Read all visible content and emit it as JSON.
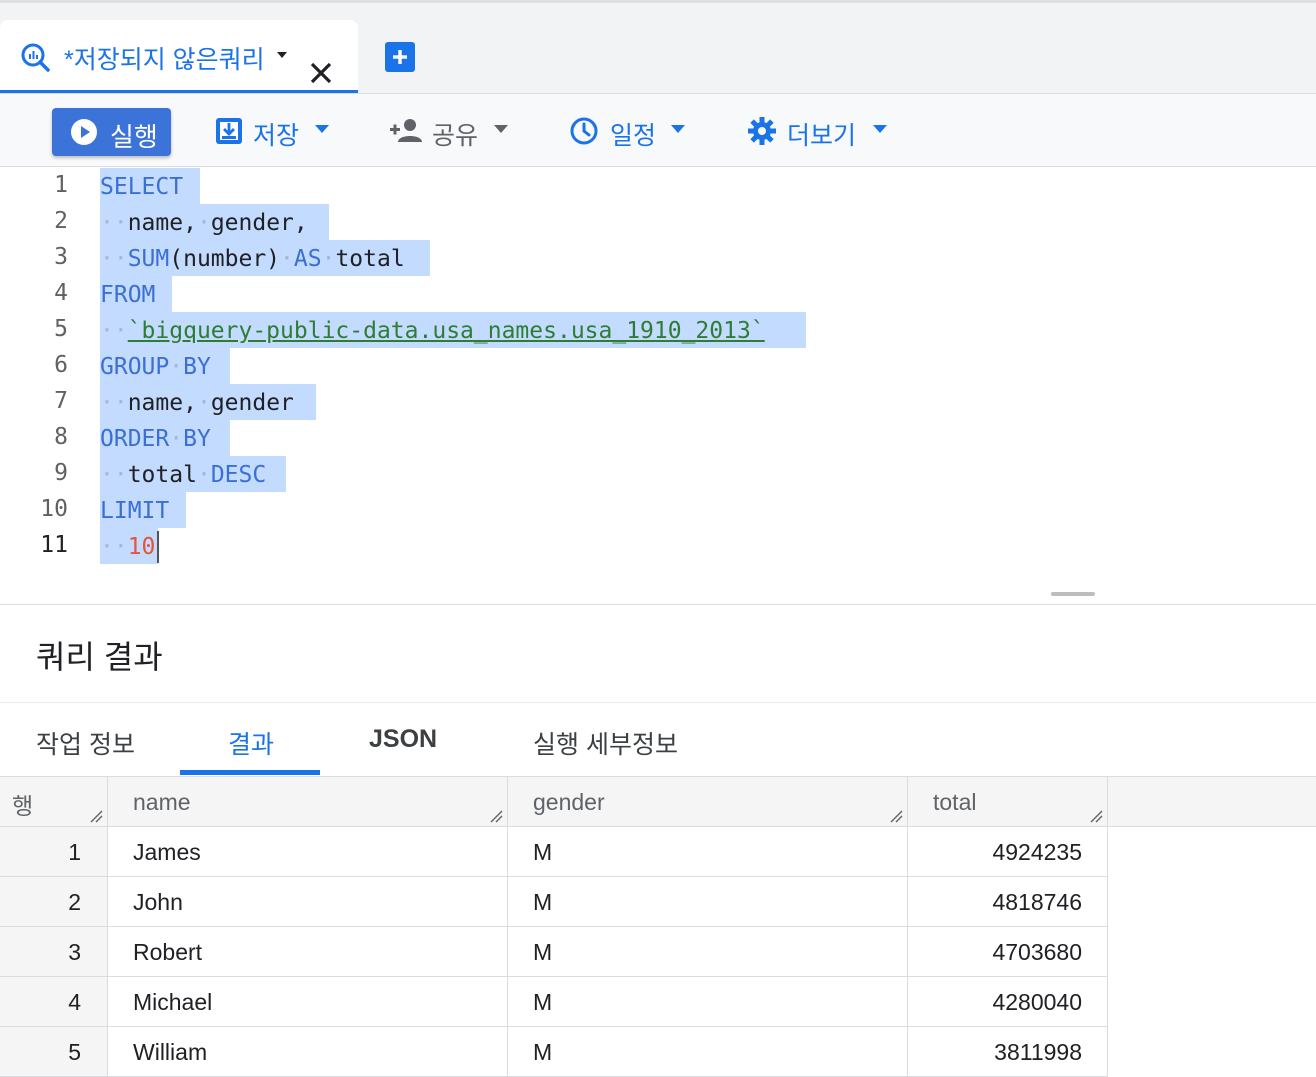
{
  "tab": {
    "title": "*저장되지 않은쿼리",
    "icon": "query-icon",
    "close_icon": "close-icon"
  },
  "new_tab_icon": "add-tab-icon",
  "toolbar": {
    "run_label": "실행",
    "save_label": "저장",
    "share_label": "공유",
    "schedule_label": "일정",
    "more_label": "더보기"
  },
  "editor": {
    "line_numbers": [
      "1",
      "2",
      "3",
      "4",
      "5",
      "6",
      "7",
      "8",
      "9",
      "10",
      "11"
    ]
  },
  "results": {
    "title": "쿼리 결과",
    "tabs": [
      "작업 정보",
      "결과",
      "JSON",
      "실행 세부정보"
    ],
    "active_tab": "결과",
    "columns": [
      "행",
      "name",
      "gender",
      "total"
    ],
    "rows": [
      {
        "row": "1",
        "name": "James",
        "gender": "M",
        "total": "4924235"
      },
      {
        "row": "2",
        "name": "John",
        "gender": "M",
        "total": "4818746"
      },
      {
        "row": "3",
        "name": "Robert",
        "gender": "M",
        "total": "4703680"
      },
      {
        "row": "4",
        "name": "Michael",
        "gender": "M",
        "total": "4280040"
      },
      {
        "row": "5",
        "name": "William",
        "gender": "M",
        "total": "3811998"
      }
    ]
  },
  "colors": {
    "accent": "#1a73e8",
    "run_button": "#3b73d9",
    "selection": "#c2dbff"
  }
}
